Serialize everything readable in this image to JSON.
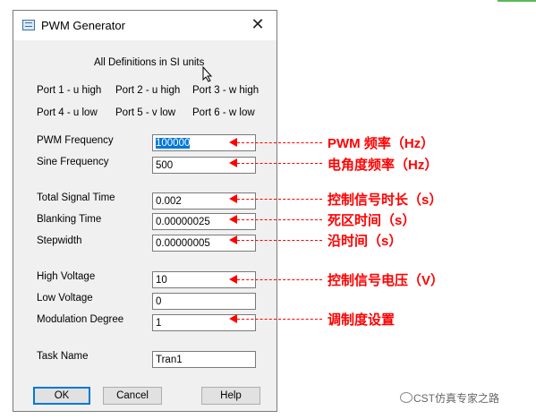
{
  "dialog": {
    "title": "PWM Generator",
    "close_symbol": "✕",
    "note": "All Definitions in SI units",
    "ports": {
      "p1": "Port 1 - u high",
      "p2": "Port 2 - u high",
      "p3": "Port 3 - w high",
      "p4": "Port 4 - u low",
      "p5": "Port 5 - v low",
      "p6": "Port 6 - w low"
    },
    "fields": {
      "pwm_frequency": {
        "label": "PWM Frequency",
        "value": "100000"
      },
      "sine_frequency": {
        "label": "Sine Frequency",
        "value": "500"
      },
      "total_signal_time": {
        "label": "Total Signal Time",
        "value": "0.002"
      },
      "blanking_time": {
        "label": "Blanking Time",
        "value": "0.00000025"
      },
      "stepwidth": {
        "label": "Stepwidth",
        "value": "0.00000005"
      },
      "high_voltage": {
        "label": "High Voltage",
        "value": "10"
      },
      "low_voltage": {
        "label": "Low Voltage",
        "value": "0"
      },
      "modulation_degree": {
        "label": "Modulation Degree",
        "value": "1"
      },
      "task_name": {
        "label": "Task Name",
        "value": "Tran1"
      }
    },
    "buttons": {
      "ok": "OK",
      "cancel": "Cancel",
      "help": "Help"
    }
  },
  "annotations": {
    "pwm_frequency": "PWM 频率（Hz）",
    "sine_frequency": "电角度频率（Hz）",
    "total_signal_time": "控制信号时长（s）",
    "blanking_time": "死区时间（s）",
    "stepwidth": "沿时间（s）",
    "high_voltage": "控制信号电压（V）",
    "modulation_degree": "调制度设置",
    "color": "#ff0000"
  },
  "watermark": "CST仿真专家之路",
  "icons": [
    "window-app-icon",
    "close-icon",
    "mouse-cursor-icon",
    "wechat-icon",
    "arrow-icon"
  ]
}
